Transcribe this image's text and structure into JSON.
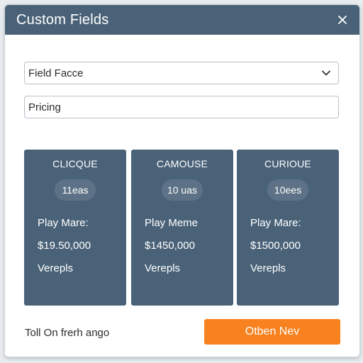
{
  "dialog": {
    "title": "Custom Fields",
    "close_icon": "close-icon"
  },
  "form": {
    "select_value": "Field Facce",
    "select_icon": "chevron-down-icon",
    "input_value": "Pricing"
  },
  "cards": [
    {
      "title": "CLICQUE",
      "pill": "11eas",
      "line1": "Play Mare:",
      "line2": "$19.50,000",
      "line3": "Verepls"
    },
    {
      "title": "CAMOUSE",
      "pill": "10 uas",
      "line1": "Play Meme",
      "line2": "$1450,000",
      "line3": "Verepls"
    },
    {
      "title": "CURIOUE",
      "pill": "10ees",
      "line1": "Play Mare:",
      "line2": "$1500,000",
      "line3": "Verepls"
    }
  ],
  "footer": {
    "text": "Toll On frerh ango",
    "button_label": "Otben Nev"
  },
  "colors": {
    "header": "#4a6278",
    "card": "#4a6278",
    "accent": "#f7821f"
  }
}
